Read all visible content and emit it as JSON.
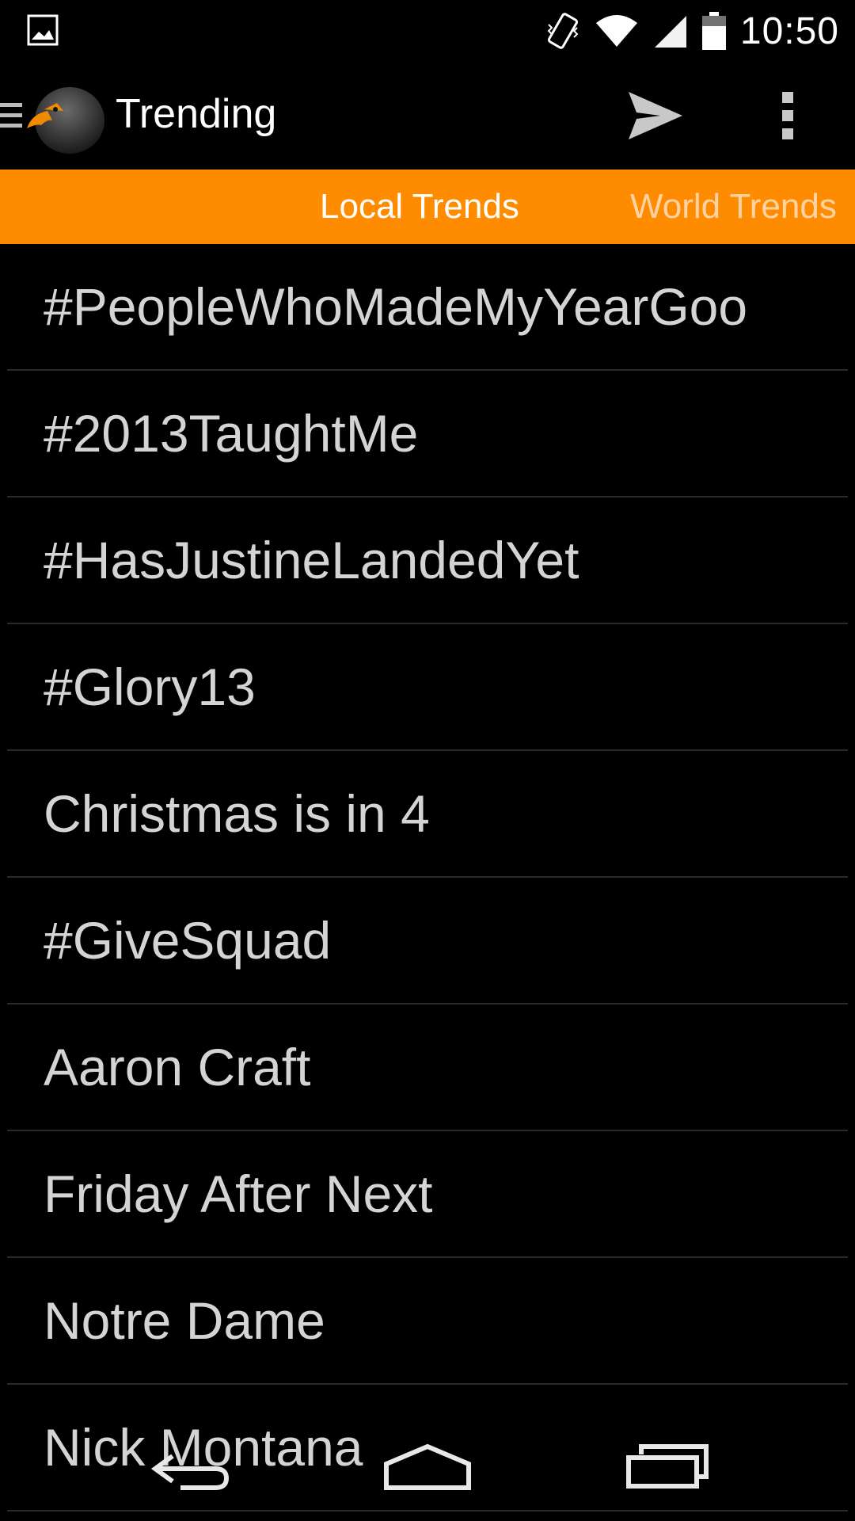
{
  "status_bar": {
    "time": "10:50",
    "icons": [
      "image-notification-icon",
      "vibrate-icon",
      "wifi-icon",
      "signal-icon",
      "battery-icon"
    ]
  },
  "action_bar": {
    "title": "Trending",
    "icons": [
      "drawer-icon",
      "app-logo-icon",
      "send-icon",
      "overflow-menu-icon"
    ]
  },
  "tabs": [
    {
      "label": "Local Trends",
      "selected": true
    },
    {
      "label": "World Trends",
      "selected": false
    }
  ],
  "trends": [
    "#PeopleWhoMadeMyYearGoo",
    "#2013TaughtMe",
    "#HasJustineLandedYet",
    "#Glory13",
    "Christmas is in 4",
    "#GiveSquad",
    "Aaron Craft",
    "Friday After Next",
    "Notre Dame",
    "Nick Montana"
  ],
  "nav_bar": {
    "icons": [
      "back-icon",
      "home-icon",
      "recents-icon"
    ]
  },
  "colors": {
    "accent": "#ff8c00",
    "background": "#000000",
    "list_text": "#d4d4d4",
    "divider": "#2a2a2a"
  }
}
